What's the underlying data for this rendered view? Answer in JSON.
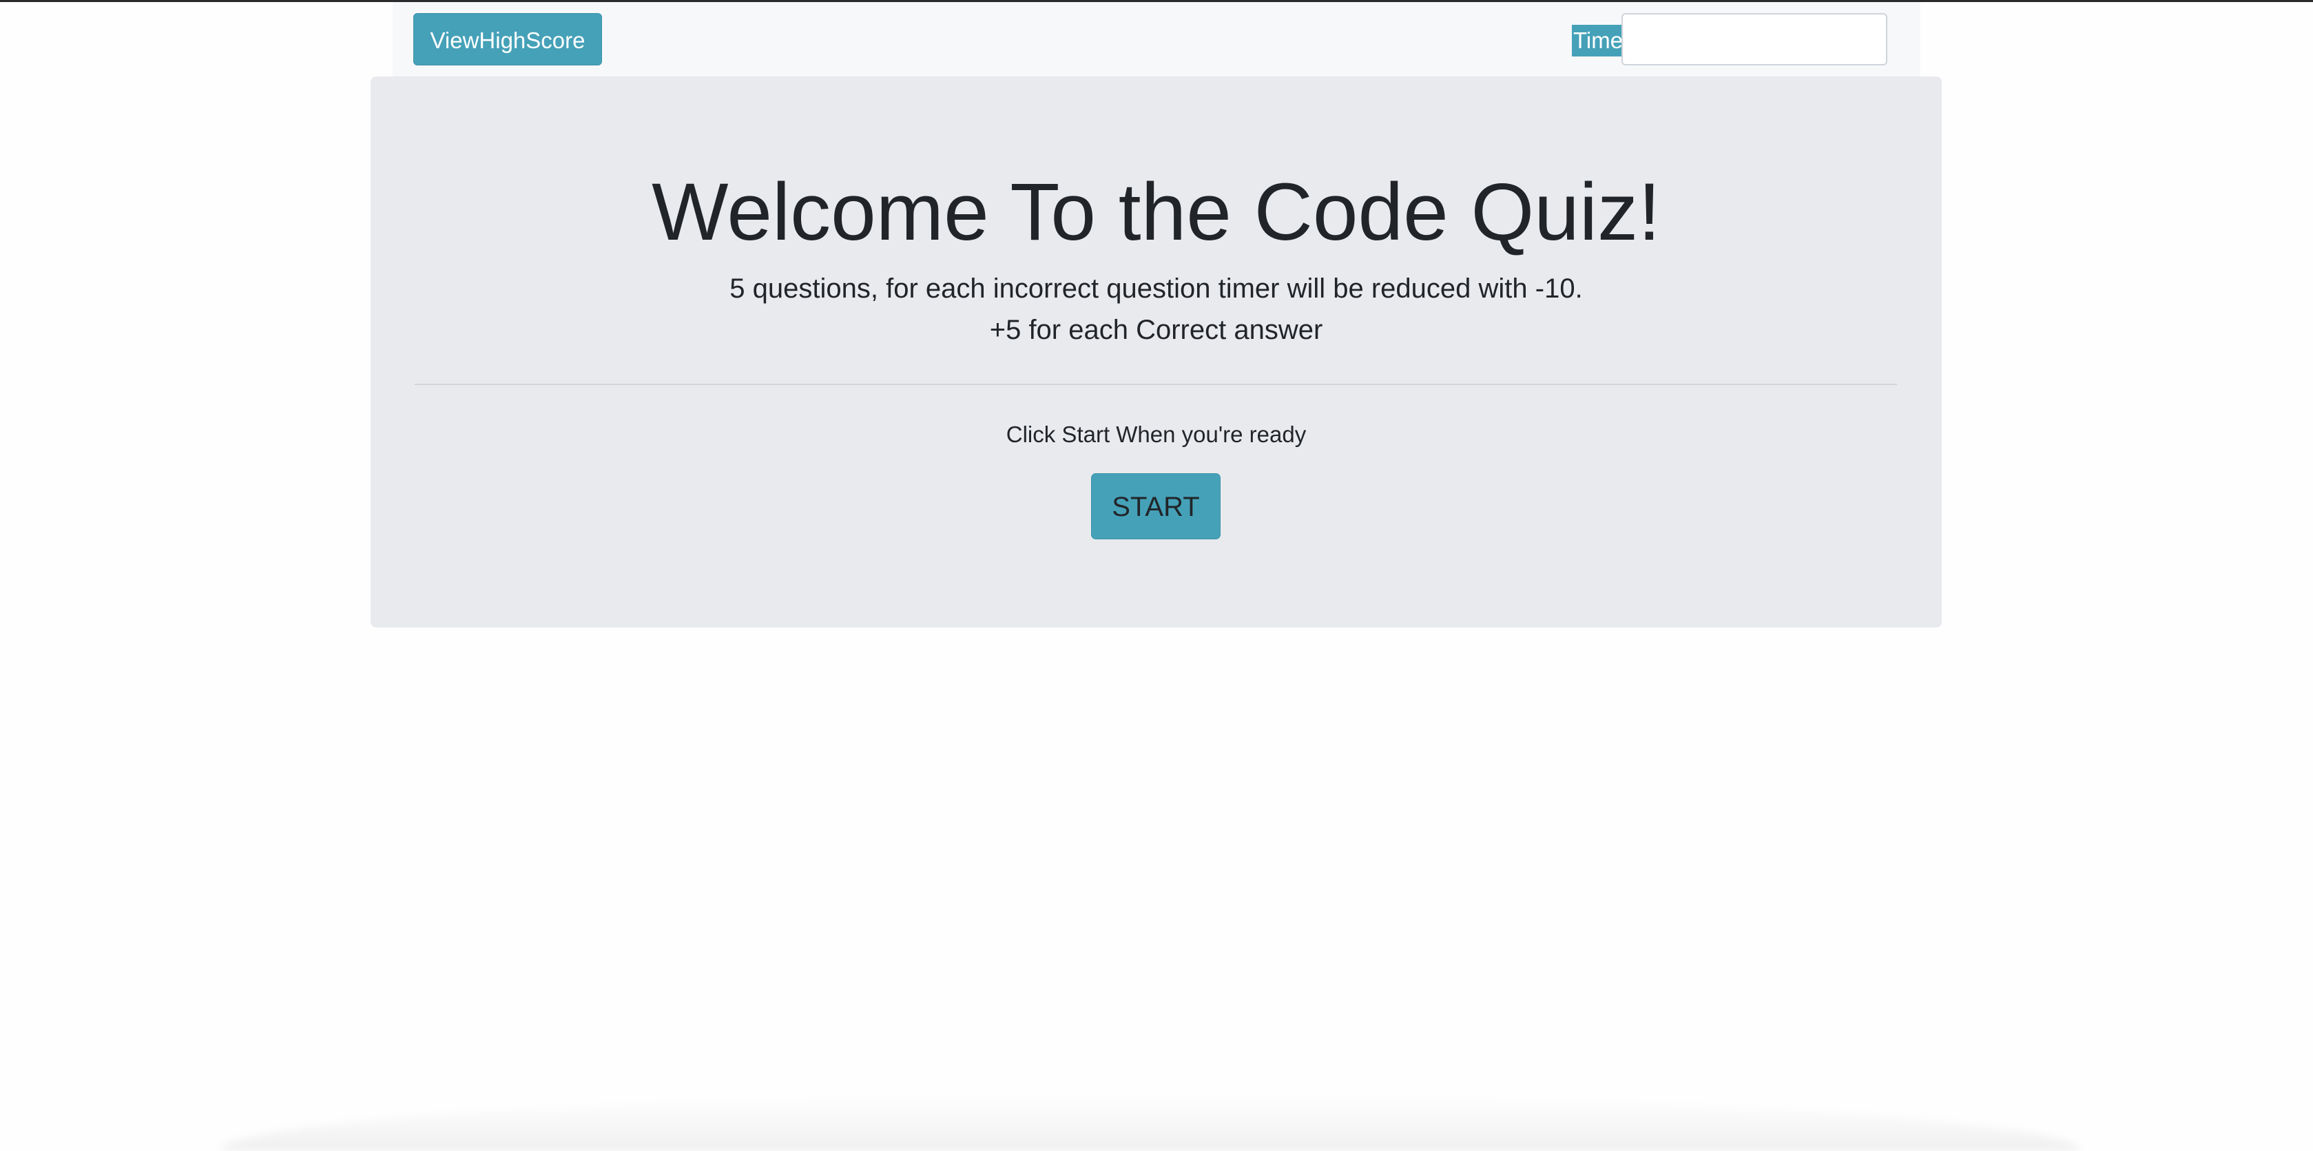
{
  "navbar": {
    "highscore_button_label": "ViewHighScore",
    "time_label": "Time",
    "time_value": ""
  },
  "intro": {
    "title": "Welcome To the Code Quiz!",
    "rules_line_1": "5 questions, for each incorrect question timer will be reduced with -10.",
    "rules_line_2": "+5 for each Correct answer",
    "ready_text": "Click Start When you're ready",
    "start_button_label": "START"
  },
  "colors": {
    "accent": "#45a1b8",
    "jumbotron_background": "#e9eaee",
    "navbar_background": "#f7f8fa",
    "text": "#212529"
  }
}
